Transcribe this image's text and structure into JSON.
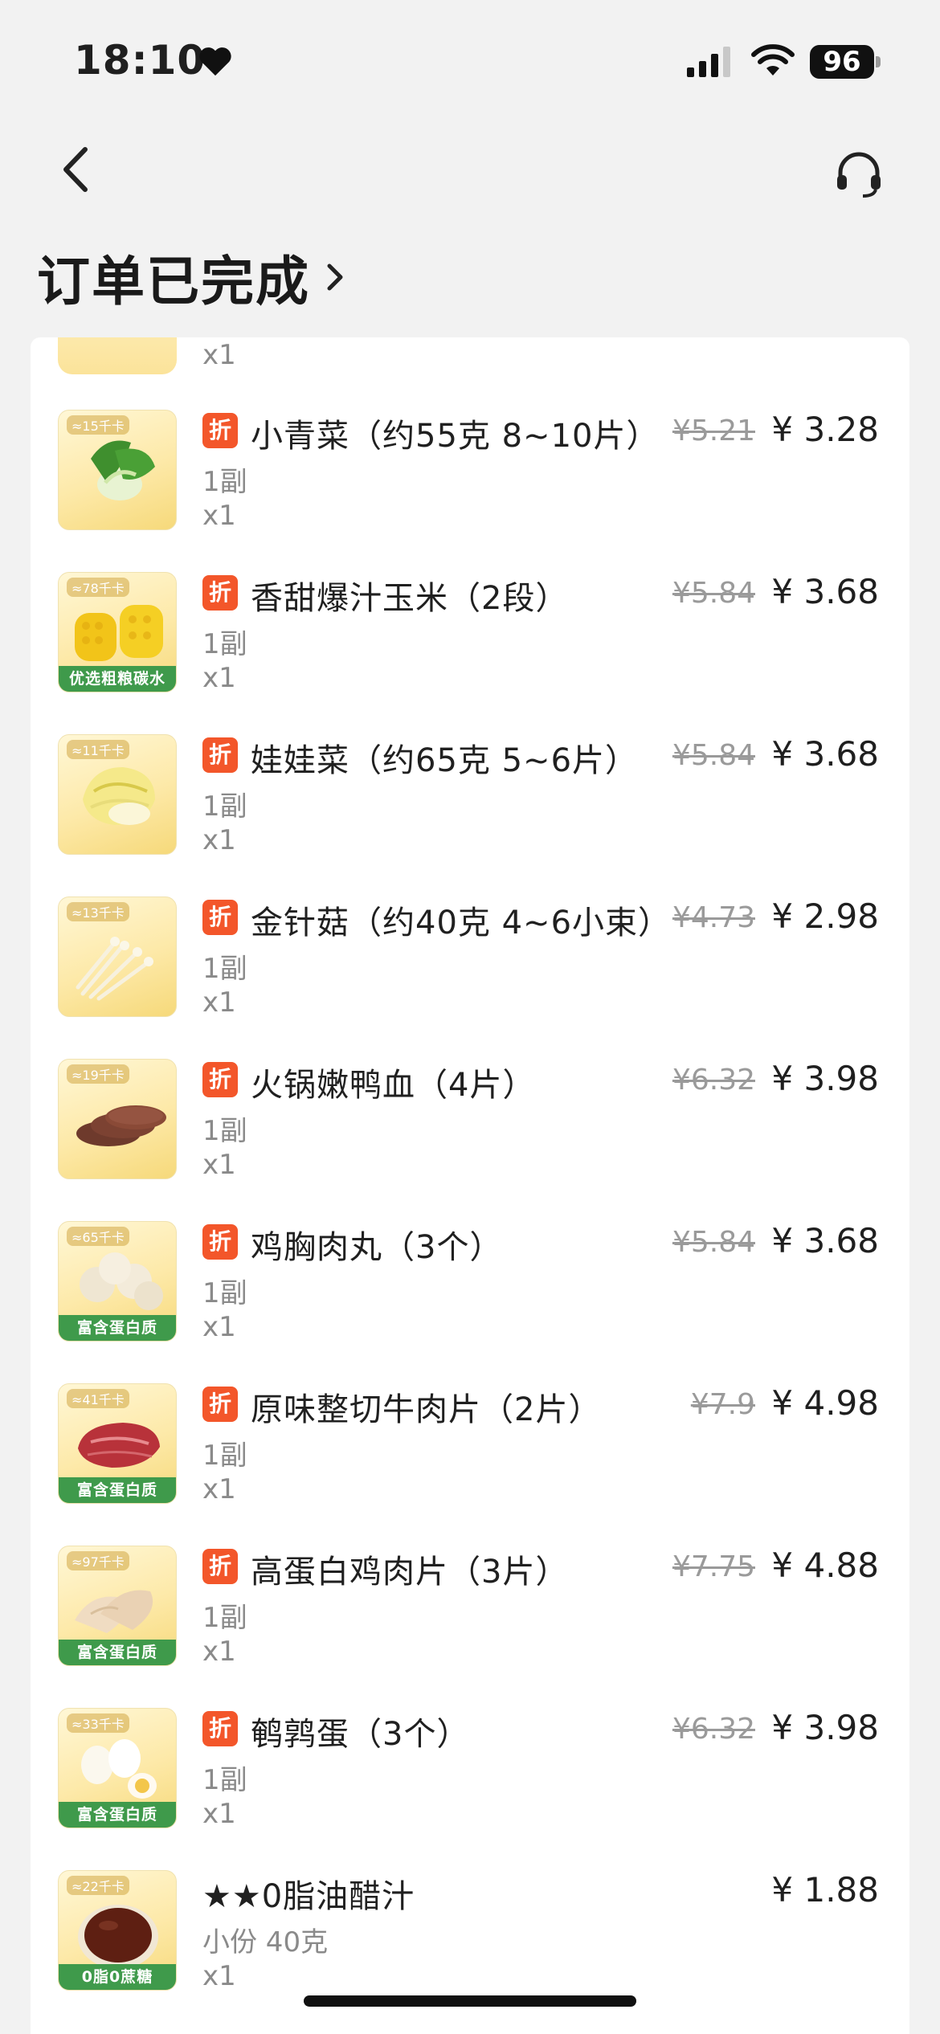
{
  "status_bar": {
    "time": "18:10",
    "battery": "96"
  },
  "header": {
    "title": "订单已完成"
  },
  "partial_item": {
    "qty": "x1"
  },
  "items": [
    {
      "name": "小青菜（约55克 8~10片）",
      "spec": "1副",
      "qty": "x1",
      "original_price": "¥5.21",
      "price": "¥ 3.28",
      "discount": "折",
      "kcal": "≈15千卡",
      "badge": "",
      "food": "greens"
    },
    {
      "name": "香甜爆汁玉米（2段）",
      "spec": "1副",
      "qty": "x1",
      "original_price": "¥5.84",
      "price": "¥ 3.68",
      "discount": "折",
      "kcal": "≈78千卡",
      "badge": "优选粗粮碳水",
      "food": "corn"
    },
    {
      "name": "娃娃菜（约65克 5~6片）",
      "spec": "1副",
      "qty": "x1",
      "original_price": "¥5.84",
      "price": "¥ 3.68",
      "discount": "折",
      "kcal": "≈11千卡",
      "badge": "",
      "food": "cabbage"
    },
    {
      "name": "金针菇（约40克 4~6小束）",
      "spec": "1副",
      "qty": "x1",
      "original_price": "¥4.73",
      "price": "¥ 2.98",
      "discount": "折",
      "kcal": "≈13千卡",
      "badge": "",
      "food": "mushroom"
    },
    {
      "name": "火锅嫩鸭血（4片）",
      "spec": "1副",
      "qty": "x1",
      "original_price": "¥6.32",
      "price": "¥ 3.98",
      "discount": "折",
      "kcal": "≈19千卡",
      "badge": "",
      "food": "blood"
    },
    {
      "name": "鸡胸肉丸（3个）",
      "spec": "1副",
      "qty": "x1",
      "original_price": "¥5.84",
      "price": "¥ 3.68",
      "discount": "折",
      "kcal": "≈65千卡",
      "badge": "富含蛋白质",
      "food": "balls"
    },
    {
      "name": "原味整切牛肉片（2片）",
      "spec": "1副",
      "qty": "x1",
      "original_price": "¥7.9",
      "price": "¥ 4.98",
      "discount": "折",
      "kcal": "≈41千卡",
      "badge": "富含蛋白质",
      "food": "beef"
    },
    {
      "name": "高蛋白鸡肉片（3片）",
      "spec": "1副",
      "qty": "x1",
      "original_price": "¥7.75",
      "price": "¥ 4.88",
      "discount": "折",
      "kcal": "≈97千卡",
      "badge": "富含蛋白质",
      "food": "chicken"
    },
    {
      "name": "鹌鹑蛋（3个）",
      "spec": "1副",
      "qty": "x1",
      "original_price": "¥6.32",
      "price": "¥ 3.98",
      "discount": "折",
      "kcal": "≈33千卡",
      "badge": "富含蛋白质",
      "food": "eggs"
    },
    {
      "name": "★★0脂油醋汁",
      "spec": "小份 40克",
      "qty": "x1",
      "original_price": "",
      "price": "¥ 1.88",
      "discount": "",
      "kcal": "≈22千卡",
      "badge": "0脂0蔗糖",
      "food": "sauce"
    }
  ]
}
